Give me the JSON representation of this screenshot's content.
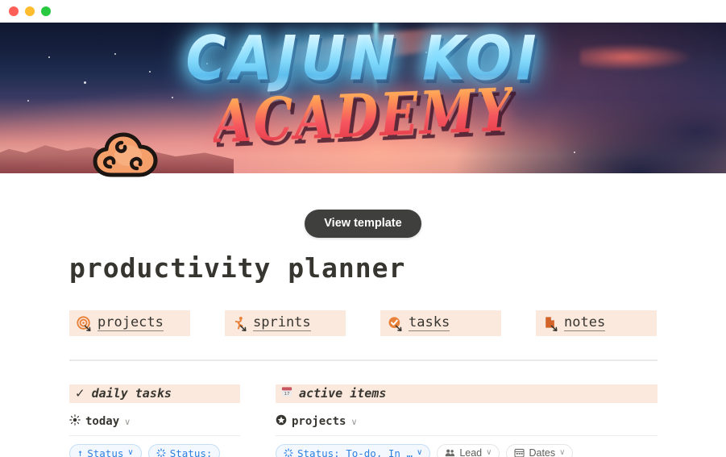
{
  "window": {
    "traffic_lights": [
      {
        "name": "close",
        "color": "#ff5f57"
      },
      {
        "name": "minimize",
        "color": "#febc2e"
      },
      {
        "name": "maximize",
        "color": "#28c840"
      }
    ]
  },
  "cover": {
    "title_line1": "CAJUN KOI",
    "title_line2": "ACADEMY",
    "icon": "orange-cloud-icon"
  },
  "actions": {
    "view_template_label": "View template"
  },
  "page": {
    "title": "productivity planner"
  },
  "cards": [
    {
      "label": "projects",
      "icon": "target-icon",
      "icon_color": "#e8813a"
    },
    {
      "label": "sprints",
      "icon": "running-icon",
      "icon_color": "#e8813a"
    },
    {
      "label": "tasks",
      "icon": "check-circle-icon",
      "icon_color": "#e8813a"
    },
    {
      "label": "notes",
      "icon": "document-icon",
      "icon_color": "#d2642a"
    }
  ],
  "columns": {
    "left": {
      "header": {
        "icon": "checkmark-icon",
        "icon_glyph": "✓",
        "title": "daily tasks"
      },
      "view": {
        "icon": "sun-icon",
        "label": "today",
        "chevron": "∨"
      },
      "pills": [
        {
          "label": "Status",
          "glyph": "↑",
          "style": "blue",
          "chevron": "∨",
          "name": "sort-status-pill"
        },
        {
          "label": "Status:",
          "glyph": "✵",
          "style": "blue",
          "chevron": "",
          "name": "filter-status-pill"
        }
      ]
    },
    "right": {
      "header": {
        "icon": "calendar-icon",
        "icon_day": "17",
        "title": "active items"
      },
      "view": {
        "icon": "star-circle-icon",
        "label": "projects",
        "chevron": "∨"
      },
      "pills": [
        {
          "label": "Status: To-do, In …",
          "glyph": "✵",
          "style": "blue",
          "chevron": "∨",
          "name": "filter-status-pill"
        },
        {
          "label": "Lead",
          "glyph": "people-icon",
          "style": "gray",
          "chevron": "∨",
          "name": "filter-lead-pill"
        },
        {
          "label": "Dates",
          "glyph": "calendar-icon",
          "style": "gray",
          "chevron": "∨",
          "name": "filter-dates-pill"
        }
      ]
    }
  },
  "colors": {
    "accent_peach": "#fbe9dd",
    "accent_orange": "#e8813a",
    "text_dark": "#37352f",
    "pill_blue": "#2f80e0",
    "button_dark": "#3f3f3e"
  }
}
